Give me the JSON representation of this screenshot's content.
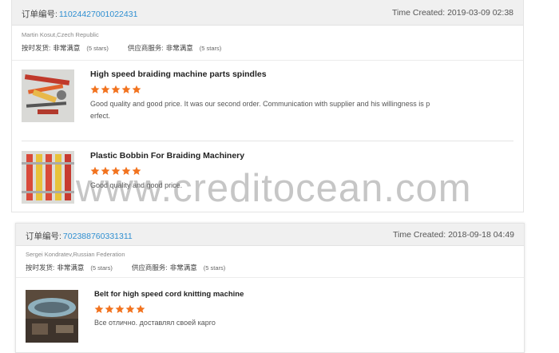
{
  "orders": [
    {
      "order_label": "订单编号:",
      "order_number": "11024427001022431",
      "time_created_label": "Time Created:",
      "time_created": "2019-03-09 02:38",
      "buyer": "Martin Kosut,Czech Republic",
      "ratings": [
        {
          "label": "按时发货:",
          "value": "非常满意",
          "stars_text": "(5 stars)"
        },
        {
          "label": "供应商服务:",
          "value": "非常满意",
          "stars_text": "(5 stars)"
        }
      ],
      "products": [
        {
          "title": "High speed braiding machine parts spindles",
          "stars": 5,
          "feedback_line1": "Good quality and good price. It was our second order. Communication with supplier and his willingness is p",
          "feedback_line2": "erfect.",
          "thumb_icon": "spindle-parts-photo"
        },
        {
          "title": "Plastic Bobbin For Braiding Machinery",
          "stars": 5,
          "feedback_line1": "Good quality and good price.",
          "thumb_icon": "bobbin-photo"
        }
      ]
    },
    {
      "order_label": "订单编号:",
      "order_number": "702388760331311",
      "time_created_label": "Time Created:",
      "time_created": "2018-09-18 04:49",
      "buyer": "Sergei Kondratev,Russian Federation",
      "ratings": [
        {
          "label": "按时发货:",
          "value": "非常满意",
          "stars_text": "(5 stars)"
        },
        {
          "label": "供应商服务:",
          "value": "非常满意",
          "stars_text": "(5 stars)"
        }
      ],
      "products": [
        {
          "title": "Belt for high speed cord knitting machine",
          "stars": 5,
          "feedback_line1": "Все отлично. доставлял своей карго",
          "thumb_icon": "belt-photo"
        }
      ]
    }
  ],
  "watermark": "www.creditocean.com",
  "colors": {
    "star": "#f2731f",
    "link": "#2f8fd1",
    "header_bg": "#f0f0f0"
  }
}
